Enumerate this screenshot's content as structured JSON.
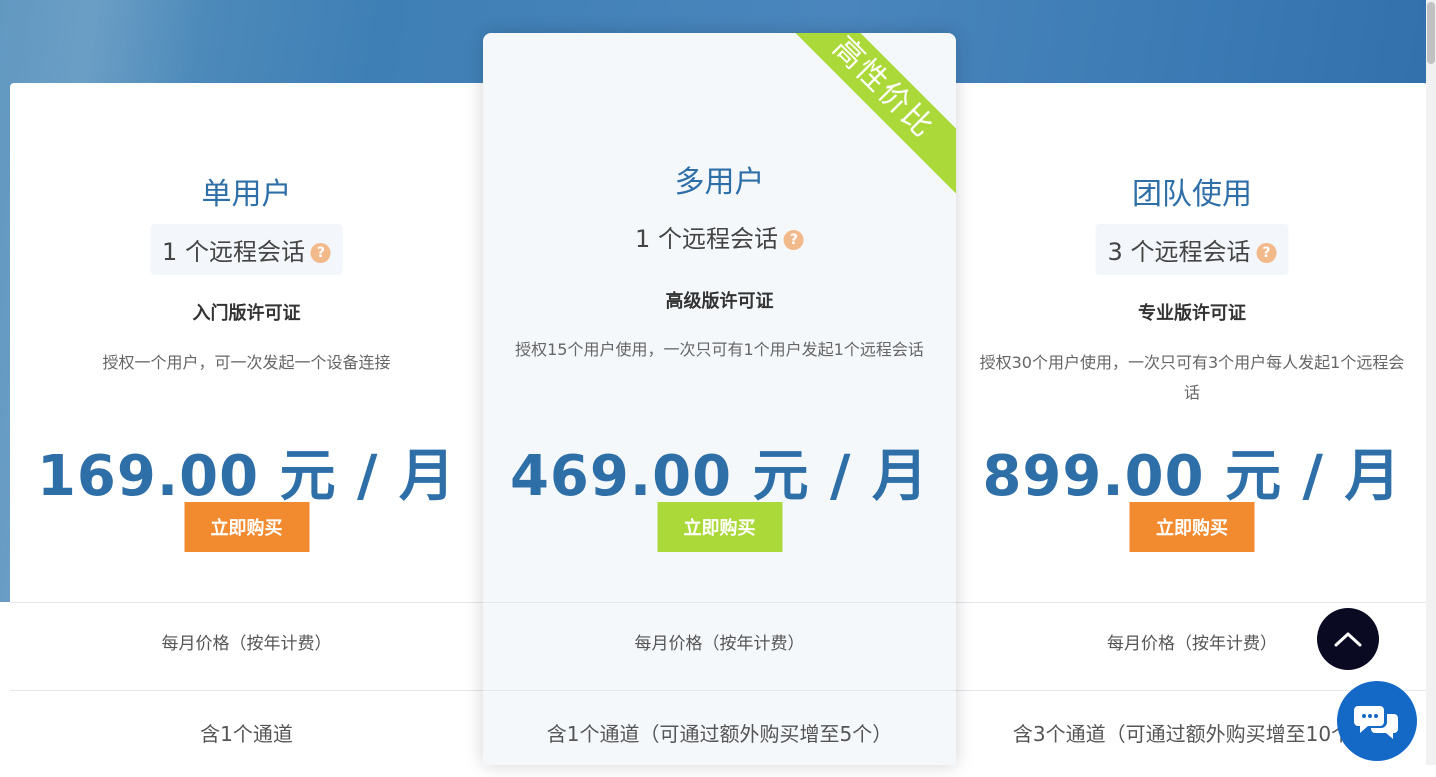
{
  "plans": [
    {
      "id": "single",
      "title": "单用户",
      "sessions": "1 个远程会话",
      "help_glyph": "?",
      "edition": "入门版许可证",
      "description": "授权一个用户，可一次发起一个设备连接",
      "price": "169.00 元 / 月",
      "buy_label": "立即购买",
      "button_color": "#f28b30",
      "monthly_note": "每月价格（按年计费）",
      "channels": "含1个通道"
    },
    {
      "id": "multi",
      "title": "多用户",
      "sessions": "1 个远程会话",
      "help_glyph": "?",
      "edition": "高级版许可证",
      "description": "授权15个用户使用，一次只可有1个用户发起1个远程会话",
      "price": "469.00 元 / 月",
      "buy_label": "立即购买",
      "button_color": "#acd93a",
      "monthly_note": "每月价格（按年计费）",
      "channels": "含1个通道（可通过额外购买增至5个）",
      "ribbon": "高性价比"
    },
    {
      "id": "team",
      "title": "团队使用",
      "sessions": "3 个远程会话",
      "help_glyph": "?",
      "edition": "专业版许可证",
      "description": "授权30个用户使用，一次只可有3个用户每人发起1个远程会话",
      "price": "899.00 元 / 月",
      "buy_label": "立即购买",
      "button_color": "#f28b30",
      "monthly_note": "每月价格（按年计费）",
      "channels": "含3个通道（可通过额外购买增至10个）"
    }
  ],
  "colors": {
    "accent_blue": "#2f6fa8",
    "help_icon": "#f2b98a",
    "back_to_top_bg": "#0a0a23",
    "chat_bg": "#1469c7"
  },
  "icons": {
    "back_to_top": "chevron-up-icon",
    "chat": "chat-bubbles-icon",
    "help": "question-icon"
  }
}
